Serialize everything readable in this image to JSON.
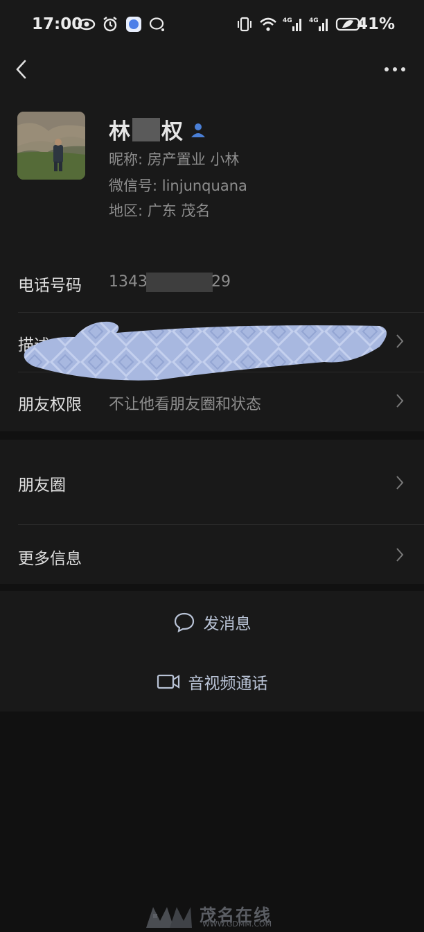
{
  "status_bar": {
    "time": "17:00",
    "battery": "41%",
    "left_icons": [
      "eye-icon",
      "alarm-icon",
      "app-badge-icon",
      "chat-bubble-icon"
    ],
    "right_icons": [
      "vibrate-icon",
      "wifi-icon",
      "signal-4g-icon",
      "signal-4g-icon",
      "battery-icon"
    ]
  },
  "nav": {
    "back_icon": "chevron-left-icon",
    "more_icon": "more-dots-icon"
  },
  "profile": {
    "name_first": "林",
    "name_last": "权",
    "nickname": "昵称: 房产置业 小林",
    "wechat_id": "微信号: linjunquana",
    "region": "地区: 广东  茂名"
  },
  "rows": {
    "phone_label": "电话号码",
    "phone_prefix": "1343",
    "phone_suffix": "29",
    "description_label": "描述",
    "friend_permission_label": "朋友权限",
    "friend_permission_value": "不让他看朋友圈和状态",
    "moments_label": "朋友圈",
    "more_info_label": "更多信息"
  },
  "actions": {
    "send_message": "发消息",
    "video_call": "音视频通话"
  },
  "watermark": {
    "brand": "茂名在线",
    "url": "WWW.GDMM.COM"
  },
  "colors": {
    "background": "#111111",
    "panel": "#191919",
    "accent_link": "#b9c3d6",
    "muted_text": "#8e8e8e",
    "scribble": "#a8b8e0"
  }
}
